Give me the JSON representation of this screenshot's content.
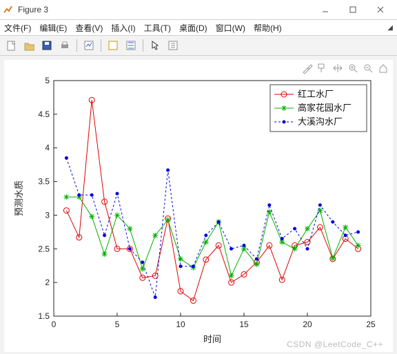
{
  "window": {
    "title": "Figure 3",
    "min_tip": "Minimize",
    "max_tip": "Maximize",
    "close_tip": "Close"
  },
  "menu": {
    "items": [
      {
        "label": "文件(F)",
        "name": "menu-file"
      },
      {
        "label": "编辑(E)",
        "name": "menu-edit"
      },
      {
        "label": "查看(V)",
        "name": "menu-view"
      },
      {
        "label": "插入(I)",
        "name": "menu-insert"
      },
      {
        "label": "工具(T)",
        "name": "menu-tools"
      },
      {
        "label": "桌面(D)",
        "name": "menu-desktop"
      },
      {
        "label": "窗口(W)",
        "name": "menu-window"
      },
      {
        "label": "帮助(H)",
        "name": "menu-help"
      }
    ]
  },
  "toolbar": {
    "items": [
      {
        "name": "new-icon"
      },
      {
        "name": "open-icon"
      },
      {
        "name": "save-icon"
      },
      {
        "name": "print-icon"
      },
      {
        "sep": true
      },
      {
        "name": "edit-plot-icon"
      },
      {
        "sep": true
      },
      {
        "name": "link-icon"
      },
      {
        "name": "inspect-icon"
      },
      {
        "sep": true
      },
      {
        "name": "cursor-icon"
      },
      {
        "name": "colorbar-icon"
      }
    ]
  },
  "axes_toolbar": {
    "items": [
      {
        "name": "brush-icon"
      },
      {
        "name": "datatip-icon"
      },
      {
        "name": "pan-icon"
      },
      {
        "name": "zoom-in-icon"
      },
      {
        "name": "zoom-out-icon"
      },
      {
        "name": "home-icon"
      }
    ]
  },
  "watermark": "CSDN @LeetCode_C++",
  "chart_data": {
    "type": "line",
    "title": "",
    "xlabel": "时间",
    "ylabel": "预测水质",
    "xlim": [
      0,
      25
    ],
    "ylim": [
      1.5,
      5.0
    ],
    "xticks": [
      0,
      5,
      10,
      15,
      20,
      25
    ],
    "yticks": [
      1.5,
      2.0,
      2.5,
      3.0,
      3.5,
      4.0,
      4.5,
      5.0
    ],
    "x": [
      1,
      2,
      3,
      4,
      5,
      6,
      7,
      8,
      9,
      10,
      11,
      12,
      13,
      14,
      15,
      16,
      17,
      18,
      19,
      20,
      21,
      22,
      23,
      24
    ],
    "series": [
      {
        "name": "红工水厂",
        "color": "#e00000",
        "marker": "o",
        "values": [
          3.07,
          2.67,
          4.71,
          3.2,
          2.5,
          2.5,
          2.07,
          2.1,
          2.95,
          1.87,
          1.73,
          2.34,
          2.55,
          2.0,
          2.12,
          2.3,
          2.55,
          2.04,
          2.55,
          2.6,
          2.82,
          2.35,
          2.65,
          2.5
        ]
      },
      {
        "name": "高家花园水厂",
        "color": "#00b000",
        "marker": "*",
        "values": [
          3.27,
          3.27,
          2.98,
          2.42,
          3.0,
          2.8,
          2.2,
          2.7,
          2.93,
          2.35,
          2.22,
          2.6,
          2.9,
          2.1,
          2.5,
          2.27,
          3.05,
          2.6,
          2.5,
          2.8,
          3.07,
          2.36,
          2.82,
          2.55
        ]
      },
      {
        "name": "大溪沟水厂",
        "color": "#0000e0",
        "marker": ".",
        "dash": true,
        "values": [
          3.85,
          3.3,
          3.3,
          2.7,
          3.32,
          2.5,
          2.3,
          1.78,
          3.67,
          2.24,
          2.24,
          2.7,
          2.9,
          2.5,
          2.55,
          2.35,
          3.15,
          2.65,
          2.8,
          2.5,
          3.15,
          2.9,
          2.7,
          2.75
        ]
      }
    ],
    "legend": {
      "position": "top-right"
    }
  }
}
